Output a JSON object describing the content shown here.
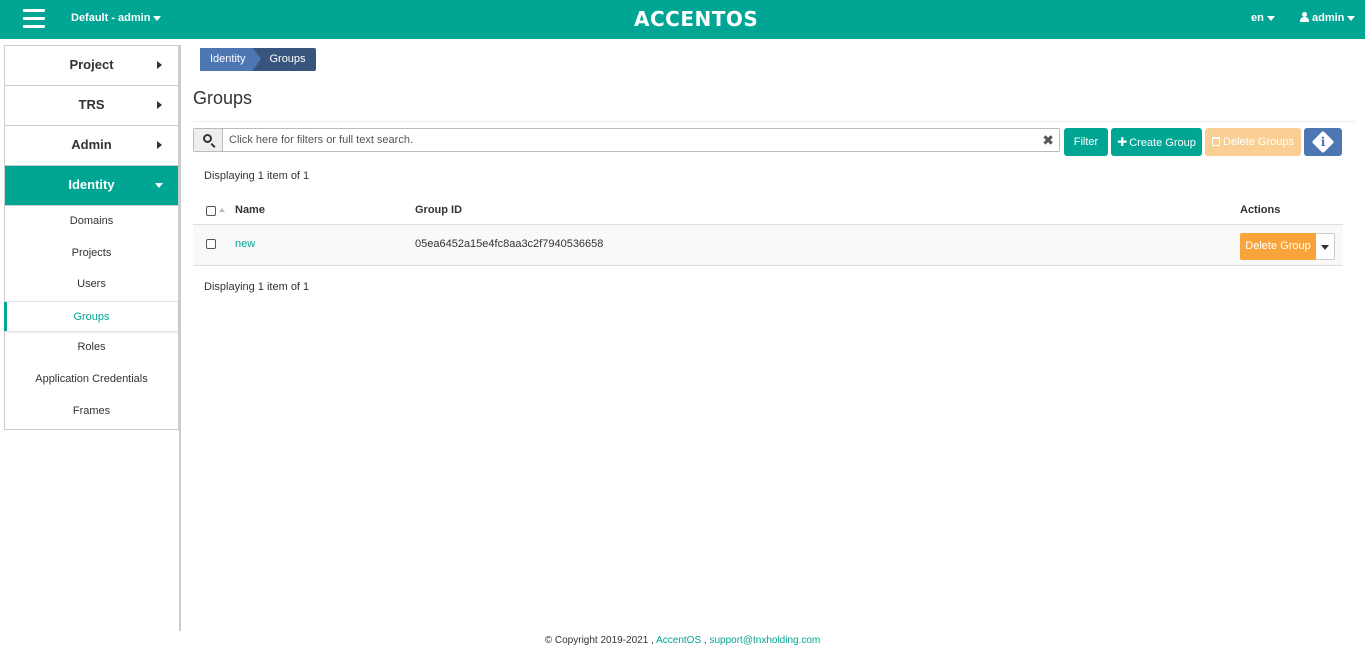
{
  "topbar": {
    "project_selector": "Default - admin",
    "logo": "ACCENTOS",
    "language": "en",
    "user": "admin"
  },
  "sidebar": {
    "sections": [
      {
        "label": "Project"
      },
      {
        "label": "TRS"
      },
      {
        "label": "Admin"
      },
      {
        "label": "Identity"
      }
    ],
    "identity_items": [
      {
        "label": "Domains"
      },
      {
        "label": "Projects"
      },
      {
        "label": "Users"
      },
      {
        "label": "Groups"
      },
      {
        "label": "Roles"
      },
      {
        "label": "Application Credentials"
      },
      {
        "label": "Frames"
      }
    ],
    "active_section": "Identity",
    "active_item": "Groups"
  },
  "breadcrumb": [
    "Identity",
    "Groups"
  ],
  "page": {
    "title": "Groups"
  },
  "search": {
    "value": "",
    "placeholder": "Click here for filters or full text search."
  },
  "toolbar": {
    "filter": "Filter",
    "create": "Create Group",
    "delete": "Delete Groups"
  },
  "table": {
    "count_text": "Displaying 1 item of 1",
    "columns": [
      "Name",
      "Group ID",
      "Actions"
    ],
    "rows": [
      {
        "name": "new",
        "group_id": "05ea6452a15e4fc8aa3c2f7940536658",
        "action": "Delete Group"
      }
    ]
  },
  "footer": {
    "copyright": "© Copyright 2019-2021 ,",
    "brand": "AccentOS",
    "separator": ",",
    "email": "support@tnxholding.com"
  },
  "colors": {
    "accent": "#00a693",
    "primary": "#4c77b3",
    "warning": "#f9a43a"
  }
}
